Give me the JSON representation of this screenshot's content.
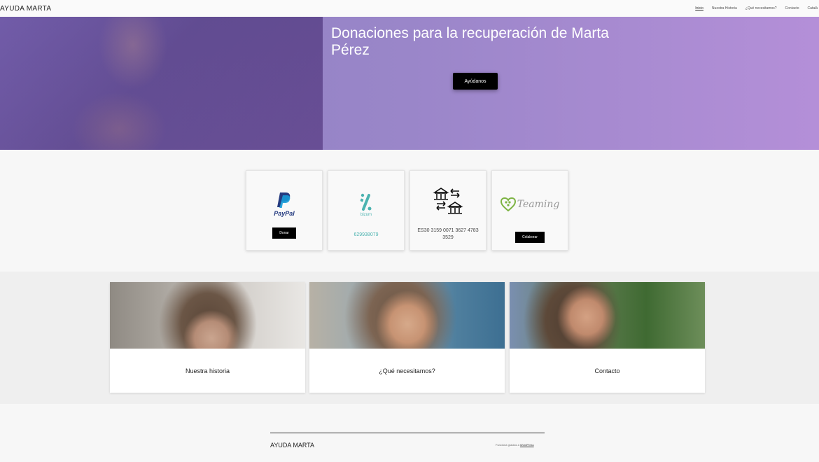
{
  "header": {
    "brand": "AYUDA MARTA",
    "nav": [
      "Inicio",
      "Nuestra Historia",
      "¿Qué necesitamos?",
      "Contacto",
      "Català"
    ]
  },
  "hero": {
    "title": "Donaciones para la recuperación de Marta Pérez",
    "button": "Ayúdanos"
  },
  "donations": {
    "paypal": {
      "logo_text": "PayPal",
      "button": "Donar"
    },
    "bizum": {
      "logo_text": "bizum",
      "number": "629938079"
    },
    "bank": {
      "iban": "ES30 3159 0071 3627 4783 3529"
    },
    "teaming": {
      "logo_text": "Teaming",
      "button": "Colaborar"
    }
  },
  "sections": [
    {
      "label": "Nuestra historia"
    },
    {
      "label": "¿Qué necesitamos?"
    },
    {
      "label": "Contacto"
    }
  ],
  "footer": {
    "brand": "AYUDA MARTA",
    "credit_prefix": "Funciona gracias a",
    "credit_link": "WordPress"
  },
  "colors": {
    "hero_gradient_start": "#8b7fc0",
    "hero_gradient_end": "#b48fd8",
    "paypal_dark": "#253b80",
    "paypal_light": "#179bd7",
    "bizum": "#4cb3b0",
    "teaming_green": "#7cb342"
  }
}
